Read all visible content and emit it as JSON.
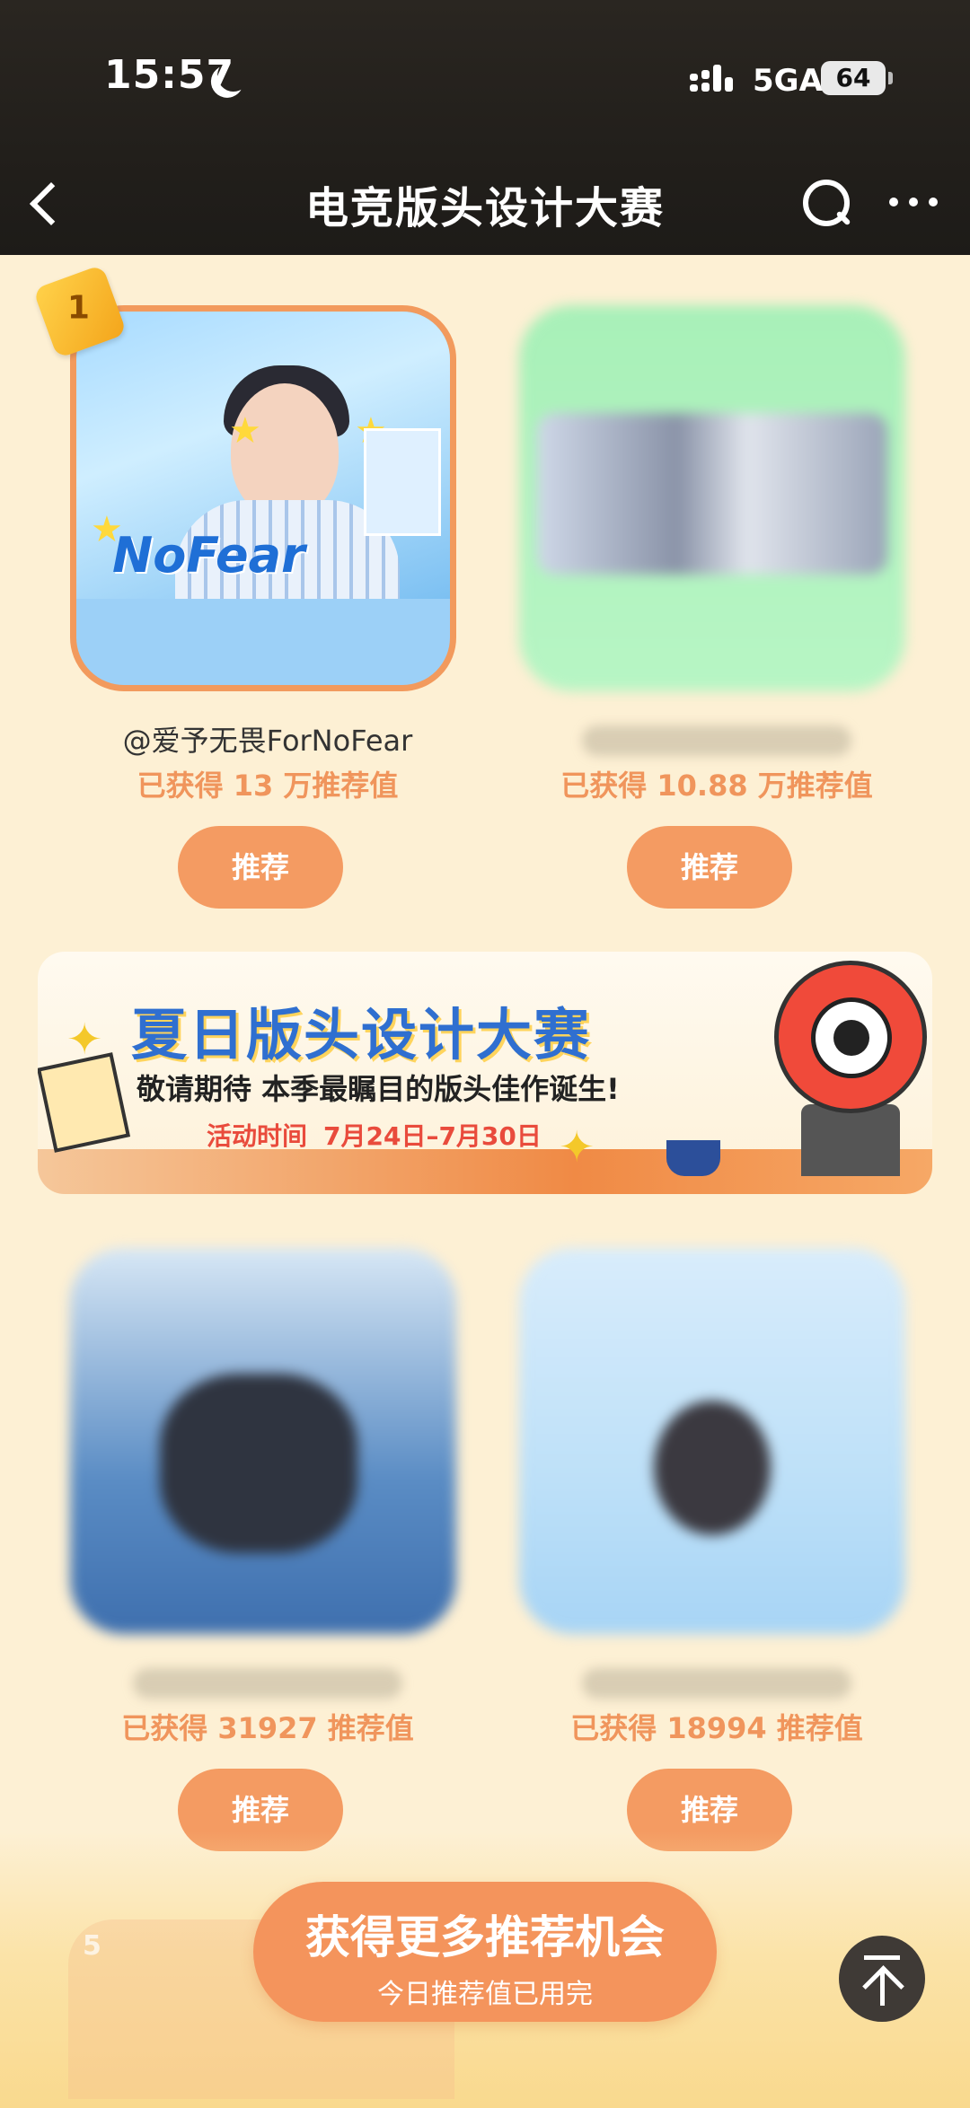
{
  "status_bar": {
    "time": "15:57",
    "network": "5GA",
    "battery": "64"
  },
  "header": {
    "title": "电竞版头设计大赛"
  },
  "cards": [
    {
      "rank": "1",
      "name": "@爱予无畏ForNoFear",
      "score": "已获得 13 万推荐值",
      "button": "推荐",
      "art_text": "NoFear"
    },
    {
      "rank": "",
      "name": "",
      "score": "已获得 10.88 万推荐值",
      "button": "推荐"
    },
    {
      "rank": "",
      "name": "",
      "score": "已获得 31927 推荐值",
      "button": "推荐"
    },
    {
      "rank": "",
      "name": "",
      "score": "已获得 18994 推荐值",
      "button": "推荐"
    }
  ],
  "banner": {
    "title": "夏日版头设计大赛",
    "subtitle": "敬请期待 本季最瞩目的版头佳作诞生!",
    "date_label": "活动时间",
    "date_value": "7月24日–7月30日"
  },
  "bottom": {
    "next_rank": "5",
    "main_button": "获得更多推荐机会",
    "main_button_sub": "今日推荐值已用完"
  },
  "icons": {
    "back": "chevron-left-icon",
    "search": "search-icon",
    "more": "more-dots-icon",
    "to_top": "arrow-up-icon",
    "moon": "moon-icon"
  },
  "colors": {
    "accent": "#f49b62",
    "score_text": "#f0955c",
    "background": "#fdf0d4",
    "header_bg": "#221f1b"
  }
}
